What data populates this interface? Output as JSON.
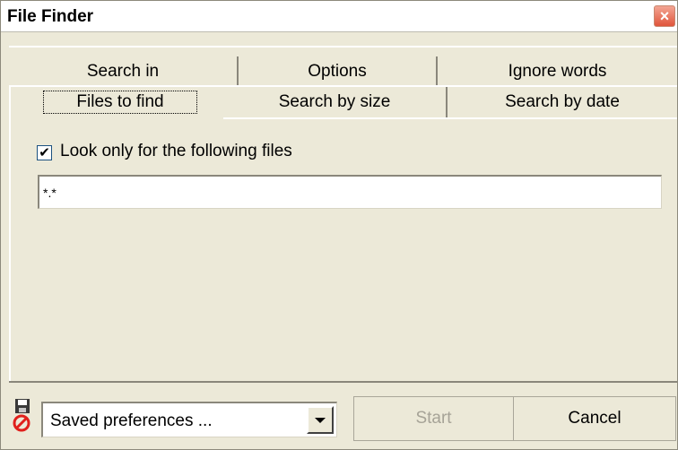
{
  "window": {
    "title": "File Finder",
    "close_label": "×"
  },
  "tabs": {
    "row1": [
      {
        "label": "Search in"
      },
      {
        "label": "Options"
      },
      {
        "label": "Ignore words"
      }
    ],
    "row2": [
      {
        "label": "Files to find",
        "active": true
      },
      {
        "label": "Search by size"
      },
      {
        "label": "Search by date"
      }
    ]
  },
  "files_tab": {
    "checkbox_label": "Look only for the following files",
    "checkbox_checked": true,
    "pattern_value": "*.*"
  },
  "footer": {
    "preferences_select_value": "Saved preferences ...",
    "start_label": "Start",
    "start_enabled": false,
    "cancel_label": "Cancel"
  },
  "icons": {
    "close": "close-icon",
    "save": "floppy-disk-icon",
    "no": "prohibited-icon",
    "dropdown": "chevron-down-icon"
  },
  "colors": {
    "window_bg": "#ece9d8",
    "close_button": "#e0553b",
    "disabled_text": "#a6a397"
  }
}
